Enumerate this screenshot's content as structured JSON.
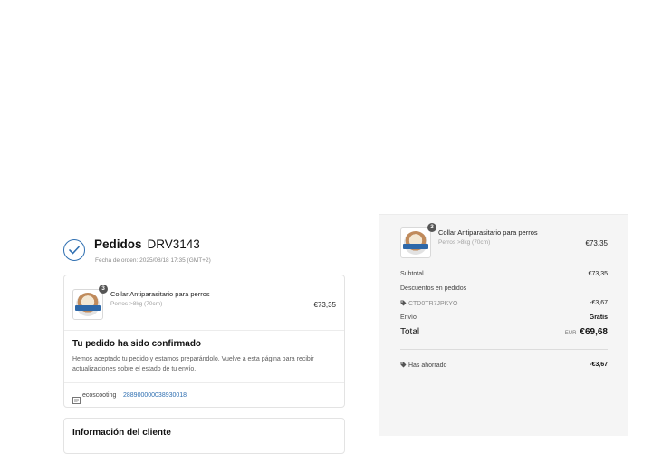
{
  "order": {
    "title": "Pedidos",
    "number": "DRV3143",
    "date_label": "Fecha de orden: 2025/08/18 17:35 (GMT+2)"
  },
  "product": {
    "quantity": "3",
    "name": "Collar Antiparasitario para perros",
    "variant": "Perros >8kg (70cm)",
    "price": "€73,35"
  },
  "confirmation": {
    "title": "Tu pedido ha sido confirmado",
    "text": "Hemos aceptado tu pedido y estamos preparándolo. Vuelve a esta página para recibir actualizaciones sobre el estado de tu envío.",
    "carrier": "ecoscooting",
    "tracking_number": "288900000038930018"
  },
  "customer": {
    "title": "Información del cliente"
  },
  "summary": {
    "subtotal_label": "Subtotal",
    "subtotal_value": "€73,35",
    "discounts_label": "Descuentos en pedidos",
    "discount_code": "CTD0TR7JPKYO",
    "discount_value": "-€3,67",
    "shipping_label": "Envío",
    "shipping_value": "Gratis",
    "total_label": "Total",
    "total_currency": "EUR",
    "total_value": "€69,68",
    "savings_label": "Has ahorrado",
    "savings_value": "-€3,67"
  },
  "colors": {
    "accent": "#2f6fb1",
    "summary_bg": "#f5f5f5"
  }
}
